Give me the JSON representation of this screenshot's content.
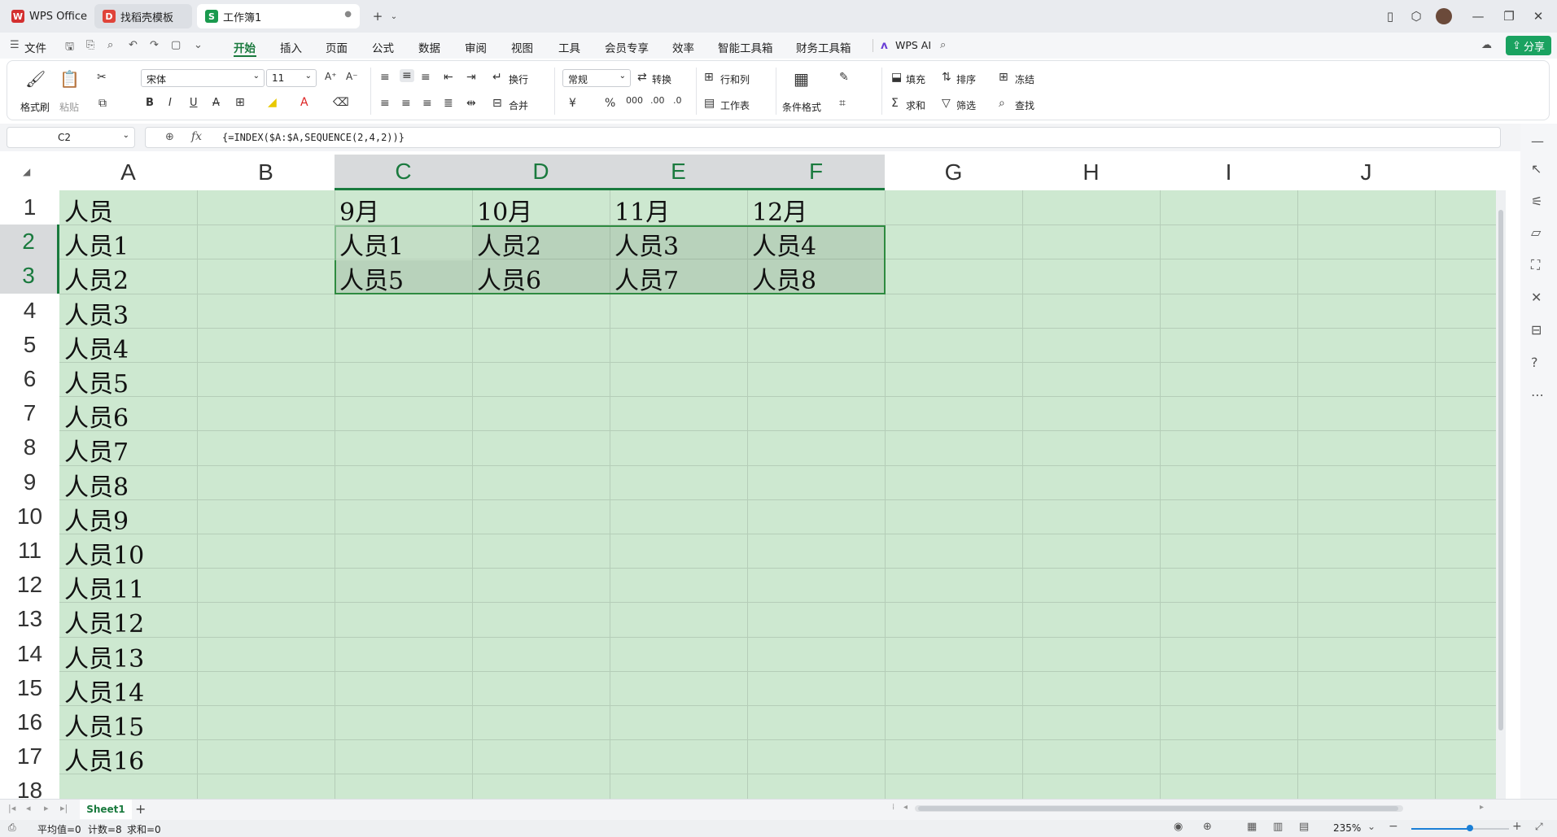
{
  "tabs": [
    {
      "label": "WPS Office",
      "icon": "wps-logo-icon",
      "color": "#d32f2f"
    },
    {
      "label": "找稻壳模板",
      "icon": "docer-icon",
      "color": "#e0443a"
    },
    {
      "label": "工作簿1",
      "icon": "spreadsheet-icon",
      "color": "#1a9a4e"
    }
  ],
  "new_tab": "+",
  "menu": {
    "file": "文件",
    "items": [
      "开始",
      "插入",
      "页面",
      "公式",
      "数据",
      "审阅",
      "视图",
      "工具",
      "会员专享",
      "效率",
      "智能工具箱",
      "财务工具箱"
    ],
    "active": "开始",
    "ai": "WPS AI",
    "share": "分享"
  },
  "ribbon": {
    "format_painter": "格式刷",
    "paste": "粘贴",
    "font_name": "宋体",
    "font_size": "11",
    "wrap": "换行",
    "merge": "合并",
    "number_format": "常规",
    "convert": "转换",
    "row_col": "行和列",
    "worksheet": "工作表",
    "cond_format": "条件格式",
    "fill": "填充",
    "sort": "排序",
    "freeze": "冻结",
    "sum": "求和",
    "filter": "筛选",
    "find": "查找"
  },
  "formula_bar": {
    "name_box": "C2",
    "fx": "fx",
    "formula": "{=INDEX($A:$A,SEQUENCE(2,4,2))}"
  },
  "columns": [
    "A",
    "B",
    "C",
    "D",
    "E",
    "F",
    "G",
    "H",
    "I",
    "J"
  ],
  "rows": [
    "1",
    "2",
    "3",
    "4",
    "5",
    "6",
    "7",
    "8",
    "9",
    "10",
    "11",
    "12",
    "13",
    "14",
    "15",
    "16",
    "17",
    "18"
  ],
  "cells": {
    "A": [
      "人员",
      "人员1",
      "人员2",
      "人员3",
      "人员4",
      "人员5",
      "人员6",
      "人员7",
      "人员8",
      "人员9",
      "人员10",
      "人员11",
      "人员12",
      "人员13",
      "人员14",
      "人员15",
      "人员16"
    ],
    "C": [
      "9月",
      "人员1",
      "人员5"
    ],
    "D": [
      "10月",
      "人员2",
      "人员6"
    ],
    "E": [
      "11月",
      "人员3",
      "人员7"
    ],
    "F": [
      "12月",
      "人员4",
      "人员8"
    ]
  },
  "sheet": {
    "name": "Sheet1",
    "add": "+"
  },
  "status": {
    "average": "平均值=0",
    "count": "计数=8",
    "sum": "求和=0",
    "zoom": "235%"
  },
  "colors": {
    "accent": "#1a7a3e",
    "grid_bg": "#cde8d0",
    "share_btn": "#1aa260"
  }
}
